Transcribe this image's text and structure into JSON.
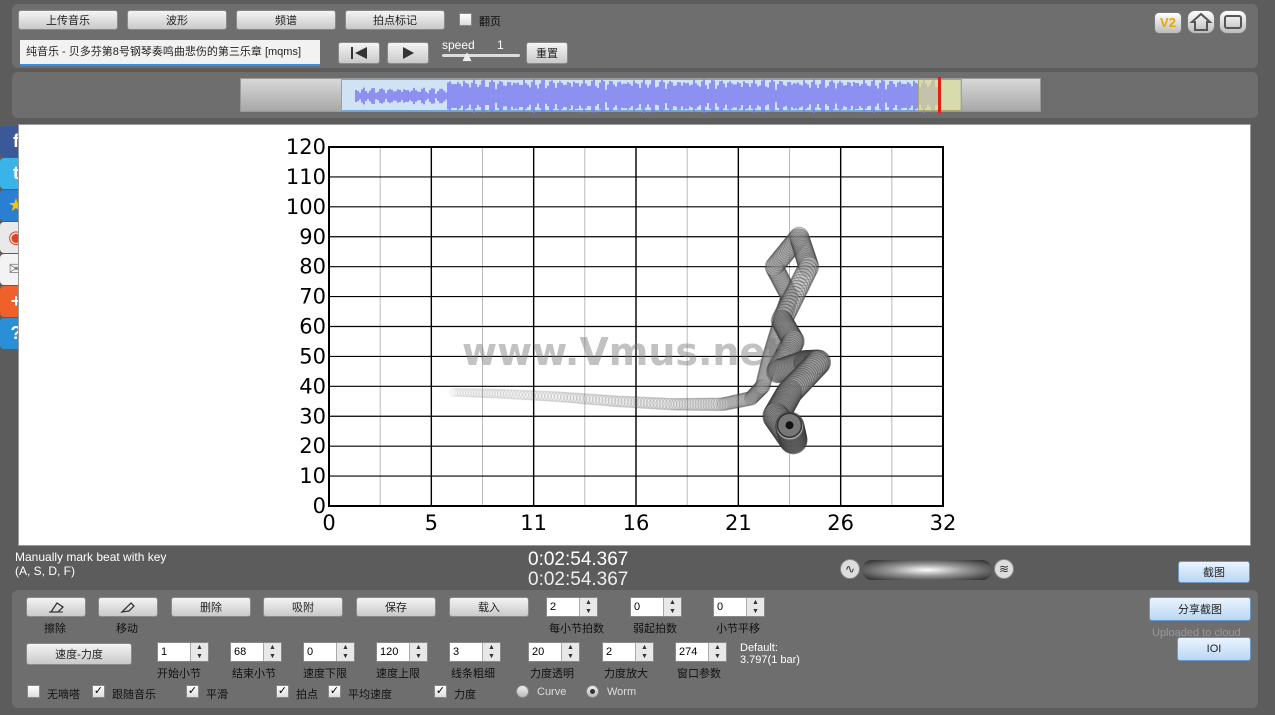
{
  "toolbar": {
    "upload_music": "上传音乐",
    "waveform": "波形",
    "spectrum": "频谱",
    "beat_marker": "拍点标记",
    "flip_page_label": "翻页",
    "song_title": "纯音乐 - 贝多芬第8号钢琴奏鸣曲悲伤的第三乐章 [mqms]",
    "speed_label": "speed",
    "speed_value": "1",
    "reset": "重置",
    "version_badge": "V2"
  },
  "overview": {
    "window_start_fraction": 0.13,
    "window_end_fraction": 0.9,
    "playhead_fraction": 0.87
  },
  "watermark": "www.Vmus.net",
  "chart_data": {
    "type": "scatter",
    "title": "",
    "xlabel": "",
    "ylabel": "",
    "x_ticks": [
      "0",
      "5",
      "11",
      "16",
      "21",
      "26",
      "32"
    ],
    "y_ticks": [
      "0",
      "10",
      "20",
      "30",
      "40",
      "50",
      "60",
      "70",
      "80",
      "90",
      "100",
      "110",
      "120"
    ],
    "xlim": [
      0,
      32
    ],
    "ylim": [
      0,
      120
    ],
    "grid": true,
    "style": "worm",
    "series": [
      {
        "x": [
          6.5,
          9,
          12,
          15,
          18,
          20.5,
          22,
          22.6,
          23,
          23.5,
          24,
          23.2,
          24.5,
          25,
          23.6,
          24.2,
          23.4,
          24.8,
          25.5,
          24,
          23.3,
          24.2,
          24.0
        ],
        "y": [
          38,
          37.5,
          36.5,
          35,
          34,
          34,
          36,
          40,
          50,
          60,
          70,
          80,
          90,
          80,
          62,
          55,
          45,
          48,
          48,
          38,
          30,
          22,
          27
        ]
      }
    ]
  },
  "beat_help": {
    "line1": "Manually mark beat with key",
    "line2": "(A, S, D, F)"
  },
  "time": {
    "current": "0:02:54.367",
    "total": "0:02:54.367"
  },
  "screenshot_button": "截图",
  "share_button": "分享截图",
  "uploaded_text": "Uploaded to cloud",
  "ioi_button": "IOI",
  "row1": {
    "erase_label": "擦除",
    "move_label": "移动",
    "delete": "删除",
    "snap": "吸附",
    "save": "保存",
    "load": "载入",
    "beats_per_bar": {
      "label": "每小节拍数",
      "value": "2"
    },
    "weak_beats": {
      "label": "弱起拍数",
      "value": "0"
    },
    "bar_offset": {
      "label": "小节平移",
      "value": "0"
    }
  },
  "row2": {
    "tempo_dynamics": "速度-力度",
    "start_bar": {
      "label": "开始小节",
      "value": "1"
    },
    "end_bar": {
      "label": "结束小节",
      "value": "68"
    },
    "tempo_min": {
      "label": "速度下限",
      "value": "0"
    },
    "tempo_max": {
      "label": "速度上限",
      "value": "120"
    },
    "line_width": {
      "label": "线条粗细",
      "value": "3"
    },
    "dyn_transparency": {
      "label": "力度透明",
      "value": "20"
    },
    "dyn_scale": {
      "label": "力度放大",
      "value": "2"
    },
    "window_param": {
      "label": "窗口参数",
      "value": "274"
    },
    "default_label": "Default:",
    "default_value": "3.797(1 bar)"
  },
  "row3": {
    "no_click": {
      "label": "无嘀嗒",
      "checked": false
    },
    "follow_music": {
      "label": "跟随音乐",
      "checked": true
    },
    "smooth": {
      "label": "平滑",
      "checked": true
    },
    "beats": {
      "label": "拍点",
      "checked": true
    },
    "avg_tempo": {
      "label": "平均速度",
      "checked": true
    },
    "dynamics": {
      "label": "力度",
      "checked": true
    },
    "curve": {
      "label": "Curve",
      "selected": false
    },
    "worm": {
      "label": "Worm",
      "selected": true
    }
  },
  "check_mark": "✓"
}
